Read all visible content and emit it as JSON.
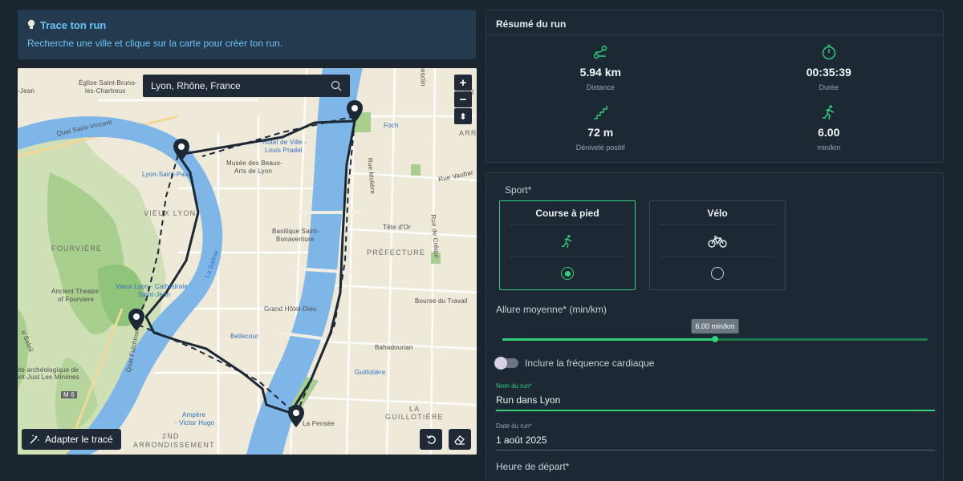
{
  "tip": {
    "title": "Trace ton run",
    "text": "Recherche une ville et clique sur la carte pour créer ton run.",
    "icon": "lightbulb-icon",
    "color": "#6ec3f5"
  },
  "map": {
    "search": {
      "value": "Lyon, Rhône, France",
      "icon": "search-icon"
    },
    "zoom_in": "+",
    "zoom_out": "−",
    "compass": "⬍",
    "adapt_label": "Adapter le tracé",
    "labels": {
      "eglise": "Église Saint-Bruno-",
      "eglise2": "les-Chartreux",
      "stjean": "-Jean",
      "quai_vincent": "Quai Saint-Vincent",
      "lyon_st_paul": "Lyon-Saint-Paul",
      "vieux_lyon": "VIEUX LYON",
      "fourviere": "FOURVIÈRE",
      "ancient_theatre": "Ancient Theatre",
      "ancient_theatre2": "of Fourviere",
      "vieux_lyon_cath": "Vieux Lyon - Cathédrale",
      "vieux_lyon_cath2": "Saint-Jean",
      "hotel_ville": "Hôtel de Ville -",
      "hotel_ville2": "Louis Pradel",
      "musee": "Musée des Beaux-",
      "musee2": "Arts de Lyon",
      "basilique": "Basilique Saint-",
      "basilique2": "Bonaventure",
      "grand_hotel": "Grand Hôtel-Dieu",
      "bellecour": "Bellecour",
      "ampere": "Ampère",
      "ampere2": "- Victor Hugo",
      "arrondissement": "2ND",
      "arrondissement2": "ARRONDISSEMENT",
      "prefecture": "PRÉFECTURE",
      "foch": "Foch",
      "rue_moliere": "Rue Molière",
      "rue_vaubar": "Rue Vaubar",
      "tete_dor": "Tête d'Or",
      "rue_crequi": "Rue de Créqui",
      "bourse": "Bourse du Travail",
      "bahadourian": "Bahadourian",
      "guillotiere_st": "Guillotière",
      "guillotiere": "LA",
      "guillotiere2": "GUILLOTIÈRE",
      "la_pensee": "La Pensée",
      "quai_fulchiron": "Quai Fulchiron",
      "saone": "La Saône",
      "archeo": "ite archéologique de",
      "archeo2": "int-Just Les Minimes",
      "m6": "M 6",
      "soleil": "u Soleil",
      "quesclin": "uesclin",
      "arr": "ARR",
      "br": "BR"
    }
  },
  "summary": {
    "title": "Résumé du run",
    "stats": [
      {
        "value": "5.94 km",
        "label": "Distance",
        "icon": "route-icon"
      },
      {
        "value": "00:35:39",
        "label": "Durée",
        "icon": "timer-icon"
      },
      {
        "value": "72 m",
        "label": "Dénivelé positif",
        "icon": "stairs-icon"
      },
      {
        "value": "6.00",
        "label": "min/km",
        "icon": "runner-icon"
      }
    ],
    "accent": "#2fd17a"
  },
  "form": {
    "sport_label": "Sport*",
    "sports": [
      {
        "name": "Course à pied",
        "icon": "runner-icon",
        "selected": true
      },
      {
        "name": "Vélo",
        "icon": "bike-icon",
        "selected": false
      }
    ],
    "pace_label": "Allure moyenne* (min/km)",
    "pace_tip": "6.00 min/km",
    "pace_fraction": 0.5,
    "heart_rate_label": "Inclure la fréquence cardiaque",
    "run_name": {
      "label": "Nom du run*",
      "value": "Run dans Lyon"
    },
    "run_date": {
      "label": "Date du run*",
      "value": "1 août 2025"
    },
    "start_label": "Heure de départ*"
  }
}
